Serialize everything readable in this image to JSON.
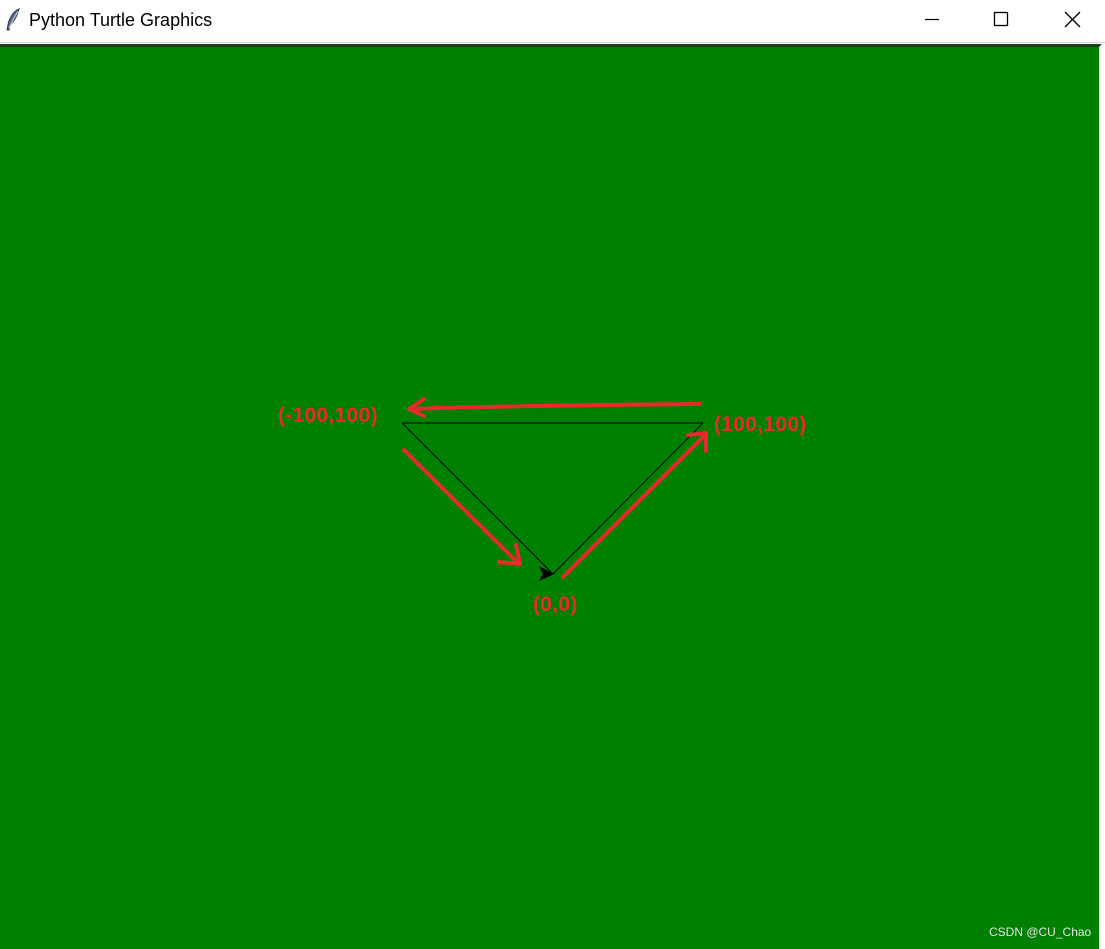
{
  "window": {
    "title": "Python Turtle Graphics",
    "icon": "feather-icon",
    "controls": {
      "minimize": "minimize-icon",
      "maximize": "maximize-icon",
      "close": "close-icon"
    }
  },
  "canvas": {
    "background_color": "#008000",
    "pen_color": "#000000",
    "annotation_color": "#e8292e"
  },
  "labels": {
    "left_vertex": "(-100,100)",
    "right_vertex": "(100,100)",
    "origin": "(0,0)"
  },
  "watermark": "CSDN @CU_Chao"
}
